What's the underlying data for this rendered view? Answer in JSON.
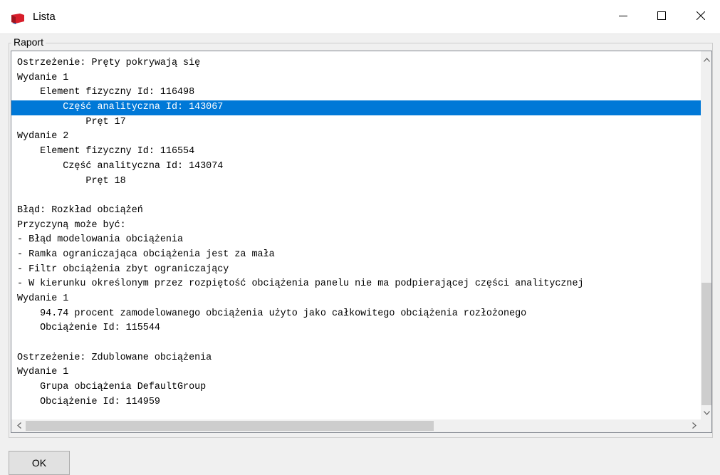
{
  "window": {
    "title": "Lista",
    "icon": "red-book-icon",
    "controls": [
      "minimize-icon",
      "maximize-icon",
      "close-icon"
    ]
  },
  "report": {
    "group_label": "Raport",
    "selected_index": 3,
    "lines": [
      "Ostrzeżenie: Pręty pokrywają się",
      "Wydanie 1",
      "    Element fizyczny Id: 116498",
      "        Część analityczna Id: 143067",
      "            Pręt 17",
      "Wydanie 2",
      "    Element fizyczny Id: 116554",
      "        Część analityczna Id: 143074",
      "            Pręt 18",
      "",
      "Błąd: Rozkład obciążeń",
      "Przyczyną może być:",
      "- Błąd modelowania obciążenia",
      "- Ramka ograniczająca obciążenia jest za mała",
      "- Filtr obciążenia zbyt ograniczający",
      "- W kierunku określonym przez rozpiętość obciążenia panelu nie ma podpierającej części analitycznej",
      "Wydanie 1",
      "    94.74 procent zamodelowanego obciążenia użyto jako całkowitego obciążenia rozłożonego",
      "    Obciążenie Id: 115544",
      "",
      "Ostrzeżenie: Zdublowane obciążenia",
      "Wydanie 1",
      "    Grupa obciążenia DefaultGroup",
      "    Obciążenie Id: 114959"
    ]
  },
  "buttons": {
    "ok_label": "OK"
  },
  "colors": {
    "selection": "#0078d7",
    "icon_red": "#d81e2b"
  }
}
